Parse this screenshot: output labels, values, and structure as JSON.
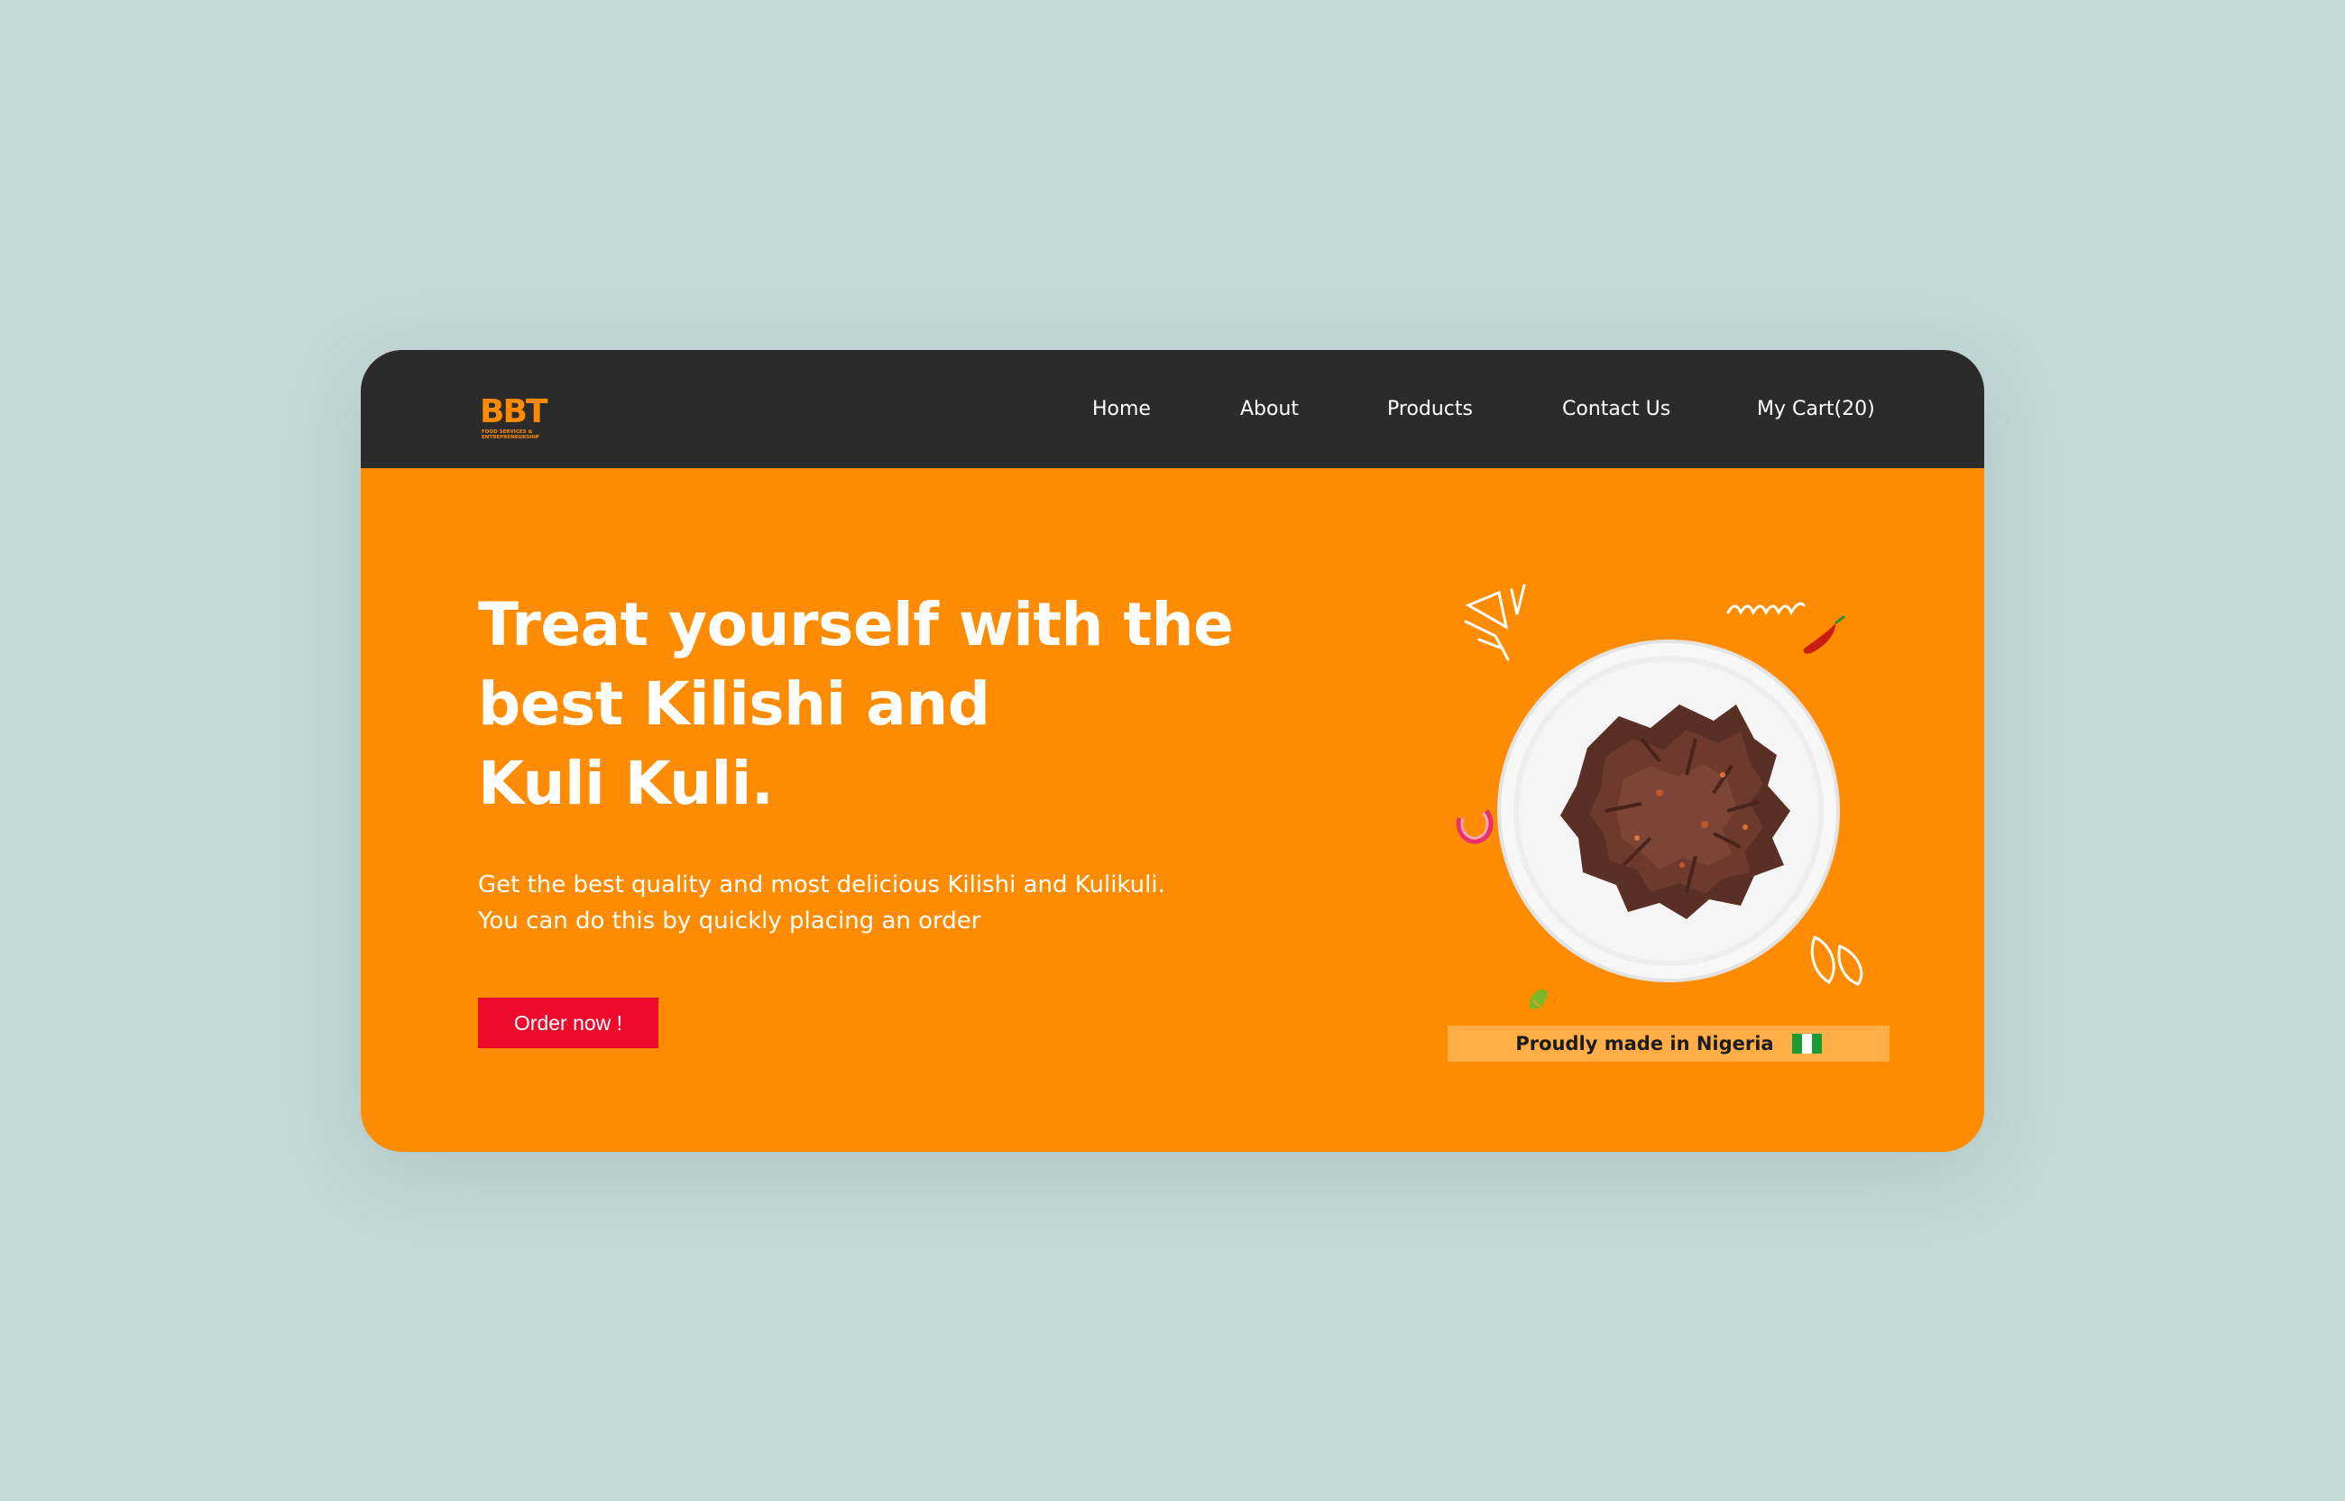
{
  "nav": {
    "logo_text": "BBT",
    "logo_sub": "FOOD SERVICES & ENTREPRENEURSHIP",
    "links": [
      "Home",
      "About",
      "Products",
      "Contact Us",
      "My Cart(20)"
    ]
  },
  "hero": {
    "headline": [
      "Treat yourself with the",
      "best Kilishi and",
      "Kuli Kuli."
    ],
    "subtext": [
      "Get the best quality and most delicious Kilishi and Kulikuli.",
      "You can do this by quickly placing an order"
    ],
    "cta_label": "Order now !"
  },
  "badge": {
    "text": "Proudly made in Nigeria",
    "flag_colors": [
      "#1a9c35",
      "#ffffff",
      "#1a9c35"
    ]
  },
  "colors": {
    "background": "#c4d8d8",
    "navbar": "#2c2b2c",
    "accent_orange": "#ff8c00",
    "cta_red": "#ee0a2d",
    "badge_bg": "#ffae48"
  },
  "icons": [
    "plate-of-kilishi",
    "red-chili-icon",
    "green-pepper-icon",
    "onion-ring-icon",
    "doodle-lines-icon"
  ]
}
